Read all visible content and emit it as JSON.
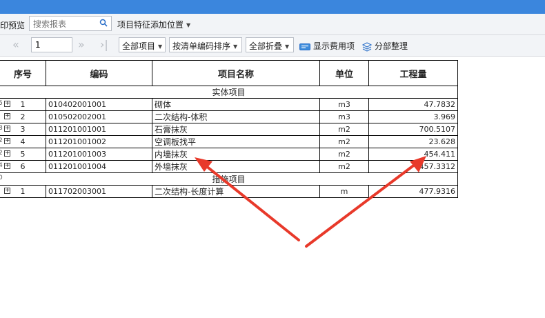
{
  "toolbar": {
    "print_preview": "印预览",
    "search_placeholder": "搜索报表",
    "feature_position": "项目特征添加位置",
    "page_value": "1",
    "filter": "全部项目",
    "sort": "按清单编码排序",
    "fold": "全部折叠",
    "show_fees": "显示费用项",
    "organize": "分部整理"
  },
  "table": {
    "headers": {
      "seq": "序号",
      "code": "编码",
      "name": "项目名称",
      "unit": "单位",
      "qty": "工程量"
    },
    "sections": [
      {
        "title": "实体项目",
        "rows": [
          {
            "seq": "1",
            "code": "010402001001",
            "name": "砌体",
            "unit": "m3",
            "qty": "47.7832"
          },
          {
            "seq": "2",
            "code": "010502002001",
            "name": "二次结构-体积",
            "unit": "m3",
            "qty": "3.969"
          },
          {
            "seq": "3",
            "code": "011201001001",
            "name": "石膏抹灰",
            "unit": "m2",
            "qty": "700.5107"
          },
          {
            "seq": "4",
            "code": "011201001002",
            "name": "空调板找平",
            "unit": "m2",
            "qty": "23.628"
          },
          {
            "seq": "5",
            "code": "011201001003",
            "name": "内墙抹灰",
            "unit": "m2",
            "qty": "454.411"
          },
          {
            "seq": "6",
            "code": "011201001004",
            "name": "外墙抹灰",
            "unit": "m2",
            "qty": "457.3312"
          }
        ]
      },
      {
        "title": "措施项目",
        "rows": [
          {
            "seq": "1",
            "code": "011702003001",
            "name": "二次结构-长度计算",
            "unit": "m",
            "qty": "477.9316"
          }
        ]
      }
    ],
    "edge_marks": [
      "",
      "5",
      "",
      "8",
      "2",
      "2",
      "4",
      "0"
    ]
  },
  "colors": {
    "titlebar": "#3b86dd",
    "arrow": "#e8392a",
    "toolbar_bg": "#f2f4f7"
  }
}
